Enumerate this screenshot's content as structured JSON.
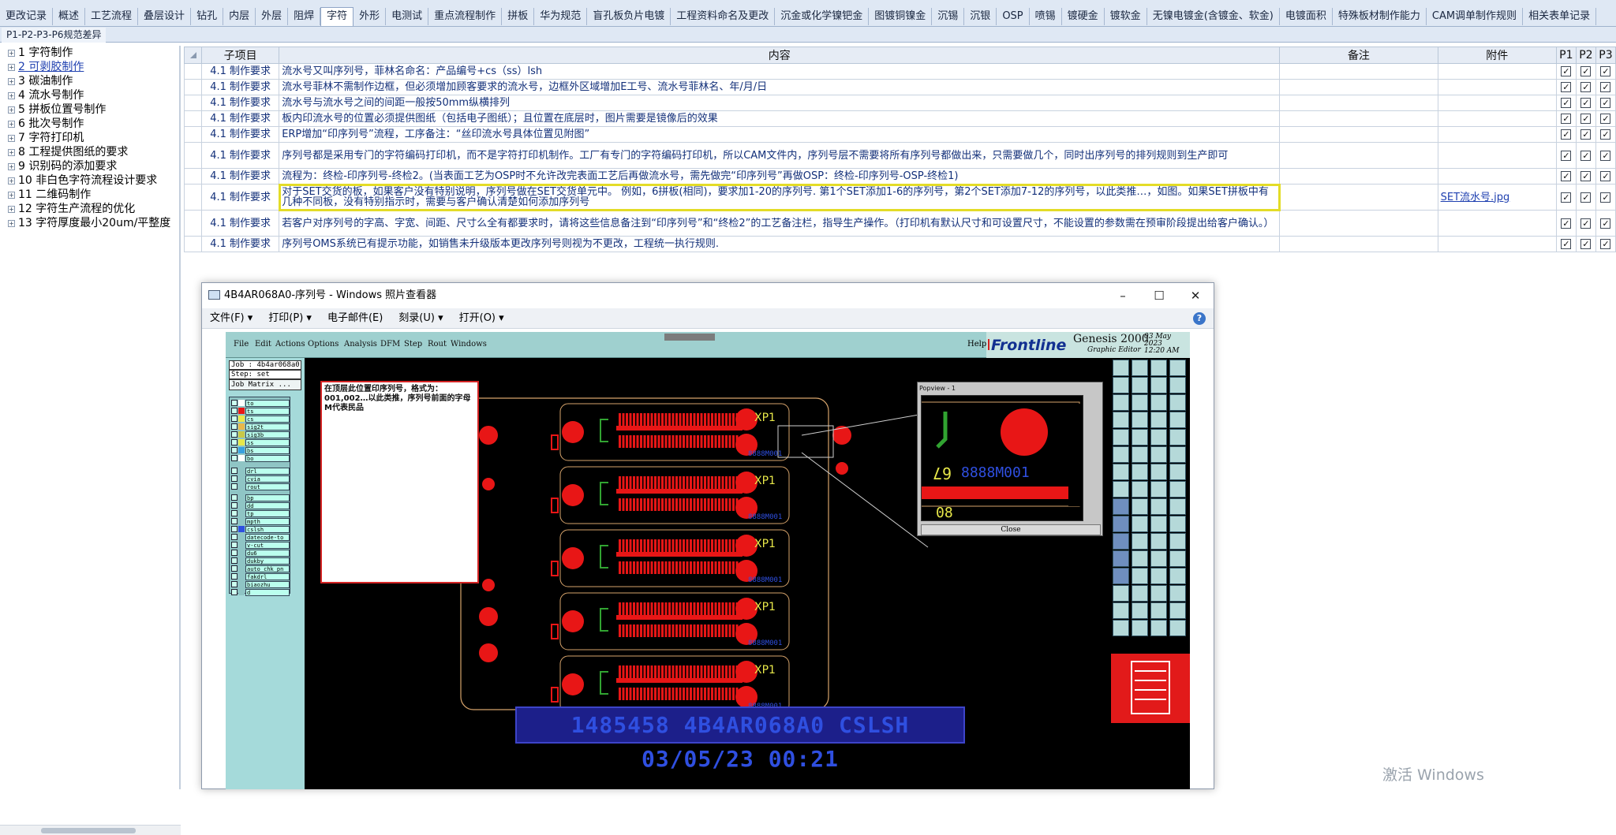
{
  "top_tabs": [
    "更改记录",
    "概述",
    "工艺流程",
    "叠层设计",
    "钻孔",
    "内层",
    "外层",
    "阻焊",
    "字符",
    "外形",
    "电测试",
    "重点流程制作",
    "拼板",
    "华为规范",
    "盲孔板负片电镀",
    "工程资料命名及更改",
    "沉金或化学镍钯金",
    "图镀铜镍金",
    "沉锡",
    "沉银",
    "OSP",
    "喷锡",
    "镀硬金",
    "镀软金",
    "无镍电镀金(含镀金、软金)",
    "电镀面积",
    "特殊板材制作能力",
    "CAM调单制作规则",
    "相关表单记录"
  ],
  "active_tab": "字符",
  "sub_tab": "P1-P2-P3-P6规范差异",
  "tree": [
    {
      "label": "1  字符制作",
      "selected": false
    },
    {
      "label": "2  可剥胶制作",
      "selected": true
    },
    {
      "label": "3  碳油制作",
      "selected": false
    },
    {
      "label": "4  流水号制作",
      "selected": false
    },
    {
      "label": "5  拼板位置号制作",
      "selected": false
    },
    {
      "label": "6  批次号制作",
      "selected": false
    },
    {
      "label": "7  字符打印机",
      "selected": false
    },
    {
      "label": "8  工程提供图纸的要求",
      "selected": false
    },
    {
      "label": "9  识别码的添加要求",
      "selected": false
    },
    {
      "label": "10  非白色字符流程设计要求",
      "selected": false
    },
    {
      "label": "11  二维码制作",
      "selected": false
    },
    {
      "label": "12  字符生产流程的优化",
      "selected": false
    },
    {
      "label": "13  字符厚度最小20um/平整度",
      "selected": false
    }
  ],
  "grid_headers": {
    "item": "子项目",
    "content": "内容",
    "remark": "备注",
    "attachment": "附件",
    "p1": "P1",
    "p2": "P2",
    "p3": "P3"
  },
  "rows": [
    {
      "item": "4.1 制作要求",
      "content": "流水号又叫序列号，菲林名命名：产品编号+cs（ss）lsh",
      "attachment": ""
    },
    {
      "item": "4.1 制作要求",
      "content": "流水号菲林不需制作边框，但必须增加顾客要求的流水号，边框外区域增加E工号、流水号菲林名、年/月/日",
      "attachment": ""
    },
    {
      "item": "4.1 制作要求",
      "content": "流水号与流水号之间的间距一般按50mm纵横排列",
      "attachment": ""
    },
    {
      "item": "4.1 制作要求",
      "content": "板内印流水号的位置必须提供图纸（包括电子图纸）；且位置在底层时，图片需要是镜像后的效果",
      "attachment": ""
    },
    {
      "item": "4.1 制作要求",
      "content": "ERP增加“印序列号”流程，工序备注：“丝印流水号具体位置见附图”",
      "attachment": ""
    },
    {
      "item": "4.1 制作要求",
      "content": "序列号都是采用专门的字符编码打印机，而不是字符打印机制作。工厂有专门的字符编码打印机，所以CAM文件内，序列号层不需要将所有序列号都做出来，只需要做几个，同时出序列号的排列规则到生产即可",
      "attachment": ""
    },
    {
      "item": "4.1 制作要求",
      "content": "流程为：终检-印序列号-终检2。(当表面工艺为OSP时不允许改完表面工艺后再做流水号，需先做完“印序列号”再做OSP：终检-印序列号-OSP-终检1)",
      "attachment": ""
    },
    {
      "item": "4.1 制作要求",
      "content": "对于SET交货的板，如果客户没有特别说明，序列号做在SET交货单元中。 例如，6拼板(相同)，要求加1-20的序列号. 第1个SET添加1-6的序列号，第2个SET添加7-12的序列号，以此类推…，如图。如果SET拼板中有几种不同板，没有特别指示时，需要与客户确认清楚如何添加序列号",
      "attachment": "SET流水号.jpg"
    },
    {
      "item": "4.1 制作要求",
      "content": "若客户对序列号的字高、字宽、间距、尺寸么全有都要求时，请将这些信息备注到“印序列号”和“终检2”的工艺备注栏，指导生产操作。（打印机有默认尺寸和可设置尺寸，不能设置的参数需在预审阶段提出给客户确认。）",
      "attachment": ""
    },
    {
      "item": "4.1 制作要求",
      "content": "序列号OMS系统已有提示功能，如销售未升级版本更改序列号则视为不更改，工程统一执行规则.",
      "attachment": ""
    }
  ],
  "viewer": {
    "title": "4B4AR068A0-序列号 - Windows 照片查看器",
    "menu": [
      "文件(F) ▾",
      "打印(P) ▾",
      "电子邮件(E)",
      "刻录(U) ▾",
      "打开(O) ▾"
    ],
    "help_icon": "?"
  },
  "genesis": {
    "menu": [
      "File",
      "Edit",
      "Actions",
      "Options",
      "Analysis",
      "DFM",
      "Step",
      "Rout",
      "Windows"
    ],
    "help": "Help",
    "brand": "Frontline",
    "product": "Genesis 2000",
    "subtitle": "Graphic Editor",
    "date": "03 May 2023",
    "time": "12:20 AM",
    "job": "Job : 4b4ar068a0",
    "step": "Step: set",
    "matrix": "Job Matrix ...",
    "layers": [
      "to",
      "ts",
      "cs",
      "sig2t",
      "sig3b",
      "ss",
      "bs",
      "bo",
      "drl",
      "cvia",
      "rout",
      "bp",
      "dd",
      "tp",
      "mpth",
      "cslsh",
      "datecode-to",
      "v-cut",
      "du6",
      "dukby",
      "auto_chk_pn",
      "fakdrl",
      "biaozhu",
      "d"
    ],
    "popview_title": "Popview - 1",
    "popview_close": "Close",
    "popview_text1": "8888M001",
    "popview_text2": "67",
    "popview_text3": "08",
    "note_text": "在顶层此位置印序列号，格式为：001,002…以此类推，序列号前面的字母M代表民品",
    "board_label": "XP1",
    "board_serial": "8888M001",
    "serial_bar": "1485458  4B4AR068A0 CSLSH 03/05/23 00:21",
    "colors": {
      "copper": "#e81616",
      "rout": "#d6a36b",
      "silk": "#e8e849",
      "serial": "#2f4fe0"
    }
  },
  "watermark": "激活 Windows"
}
